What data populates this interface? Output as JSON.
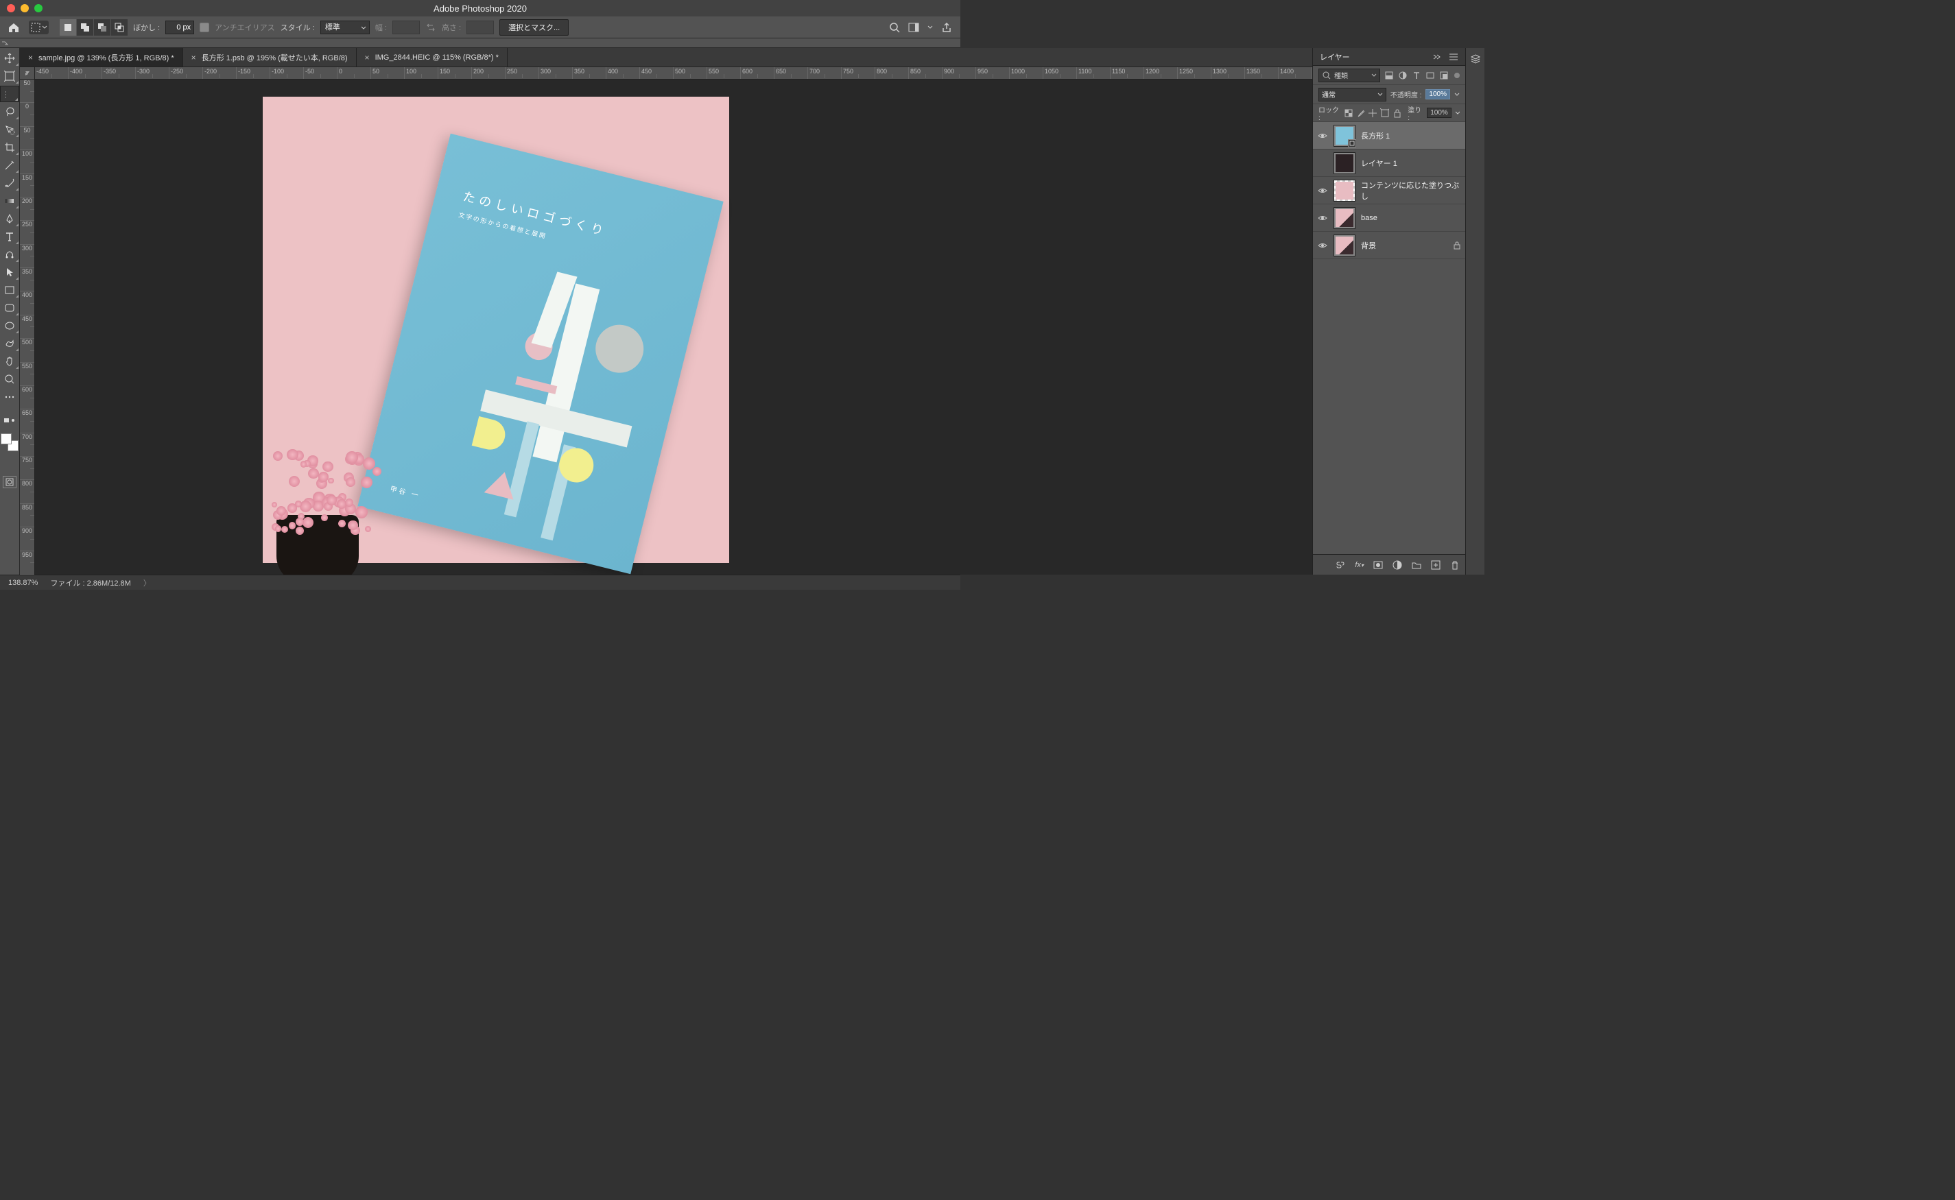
{
  "app_title": "Adobe Photoshop 2020",
  "optbar": {
    "feather_label": "ぼかし :",
    "feather_value": "0 px",
    "antialias_label": "アンチエイリアス",
    "style_label": "スタイル :",
    "style_value": "標準",
    "width_label": "幅 :",
    "height_label": "高さ :",
    "mask_button": "選択とマスク..."
  },
  "tabs": [
    {
      "label": "sample.jpg @ 139% (長方形 1, RGB/8) *"
    },
    {
      "label": "長方形 1.psb @ 195% (載せたい本, RGB/8)"
    },
    {
      "label": "IMG_2844.HEIC @ 115% (RGB/8*) *"
    }
  ],
  "ruler_h": [
    "-450",
    "-400",
    "-350",
    "-300",
    "-250",
    "-200",
    "-150",
    "-100",
    "-50",
    "0",
    "50",
    "100",
    "150",
    "200",
    "250",
    "300",
    "350",
    "400",
    "450",
    "500",
    "550",
    "600",
    "650",
    "700",
    "750",
    "800",
    "850",
    "900",
    "950",
    "1000",
    "1050",
    "1100",
    "1150",
    "1200",
    "1250",
    "1300",
    "1350",
    "1400"
  ],
  "ruler_v": [
    "50",
    "0",
    "50",
    "100",
    "150",
    "200",
    "250",
    "300",
    "350",
    "400",
    "450",
    "500",
    "550",
    "600",
    "650",
    "700",
    "750",
    "800",
    "850",
    "900",
    "950"
  ],
  "book": {
    "title": "たのしいロゴづくり",
    "subtitle": "文字の形からの着想と展開",
    "author": "甲谷 一"
  },
  "layers_panel": {
    "title": "レイヤー",
    "filter_kind": "種類",
    "blend_mode": "通常",
    "opacity_label": "不透明度 :",
    "opacity_value": "100%",
    "lock_label": "ロック :",
    "fill_label": "塗り :",
    "fill_value": "100%",
    "layers": [
      {
        "name": "長方形 1",
        "visible": true,
        "selected": true,
        "smart": true,
        "thumb": "rect"
      },
      {
        "name": "レイヤー 1",
        "visible": false,
        "thumb": "dark"
      },
      {
        "name": "コンテンツに応じた塗りつぶし",
        "visible": true,
        "thumb": "pink"
      },
      {
        "name": "base",
        "visible": true,
        "thumb": "base"
      },
      {
        "name": "背景",
        "visible": true,
        "locked": true,
        "thumb": "base"
      }
    ]
  },
  "status": {
    "zoom": "138.87%",
    "file_label": "ファイル :",
    "file_value": "2.86M/12.8M"
  }
}
